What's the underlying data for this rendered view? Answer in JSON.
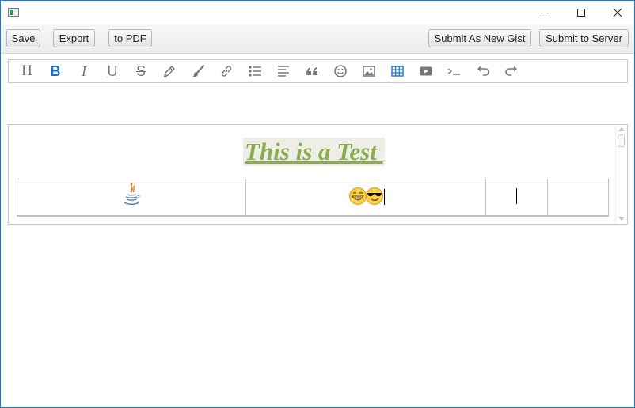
{
  "window": {
    "title": "",
    "controls": [
      "minimize-icon",
      "maximize-icon",
      "close-icon"
    ]
  },
  "toolbar": {
    "save_label": "Save",
    "export_label": "Export",
    "pdf_label": "to PDF",
    "gist_label": "Submit As New Gist",
    "server_label": "Submit to Server"
  },
  "format_bar": {
    "heading": "H",
    "bold": "B",
    "italic": "I",
    "underline": "U",
    "strike": "S",
    "icons": [
      "heading-icon",
      "bold-icon",
      "italic-icon",
      "underline-icon",
      "strikethrough-icon",
      "pencil-icon",
      "brush-icon",
      "link-icon",
      "list-icon",
      "align-left-icon",
      "quote-icon",
      "emoji-icon",
      "image-icon",
      "table-icon",
      "video-icon",
      "code-icon",
      "undo-icon",
      "redo-icon"
    ],
    "active_color": "#1a73d9"
  },
  "document": {
    "title": "This is a Test ",
    "title_color": "#8aad52",
    "title_background": "#efeee6",
    "table": {
      "cells": [
        "java-logo-icon",
        "grinning-emoji sunglasses-emoji",
        "caret",
        ""
      ]
    }
  }
}
